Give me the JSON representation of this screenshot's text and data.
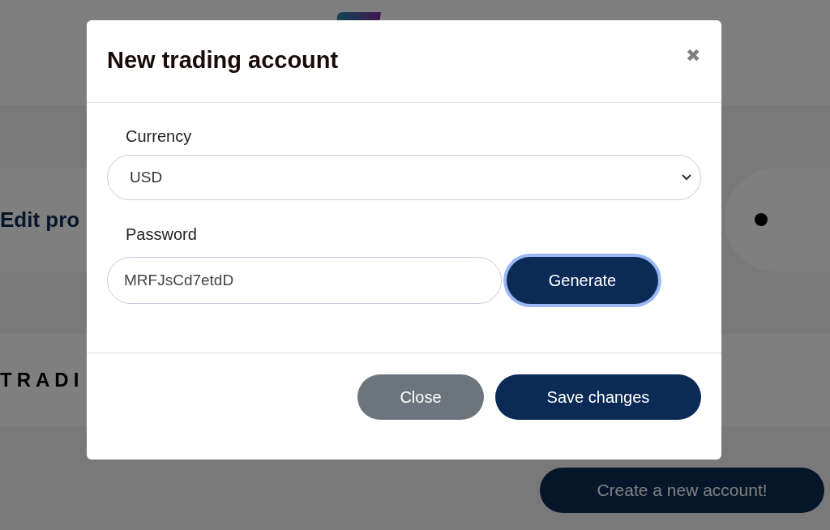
{
  "page": {
    "profile_link": "Edit pro",
    "brand_text": "TRADI",
    "create_button": "Create a new account!"
  },
  "modal": {
    "title": "New trading account",
    "close_icon": "✖",
    "currency": {
      "label": "Currency",
      "value": "USD"
    },
    "password": {
      "label": "Password",
      "value": "MRFJsCd7etdD"
    },
    "generate_button": {
      "label": "Generate",
      "focused": true
    },
    "buttons": [
      {
        "label": "Close",
        "kind": "secondary"
      },
      {
        "label": "Save changes",
        "kind": "primary"
      }
    ]
  }
}
